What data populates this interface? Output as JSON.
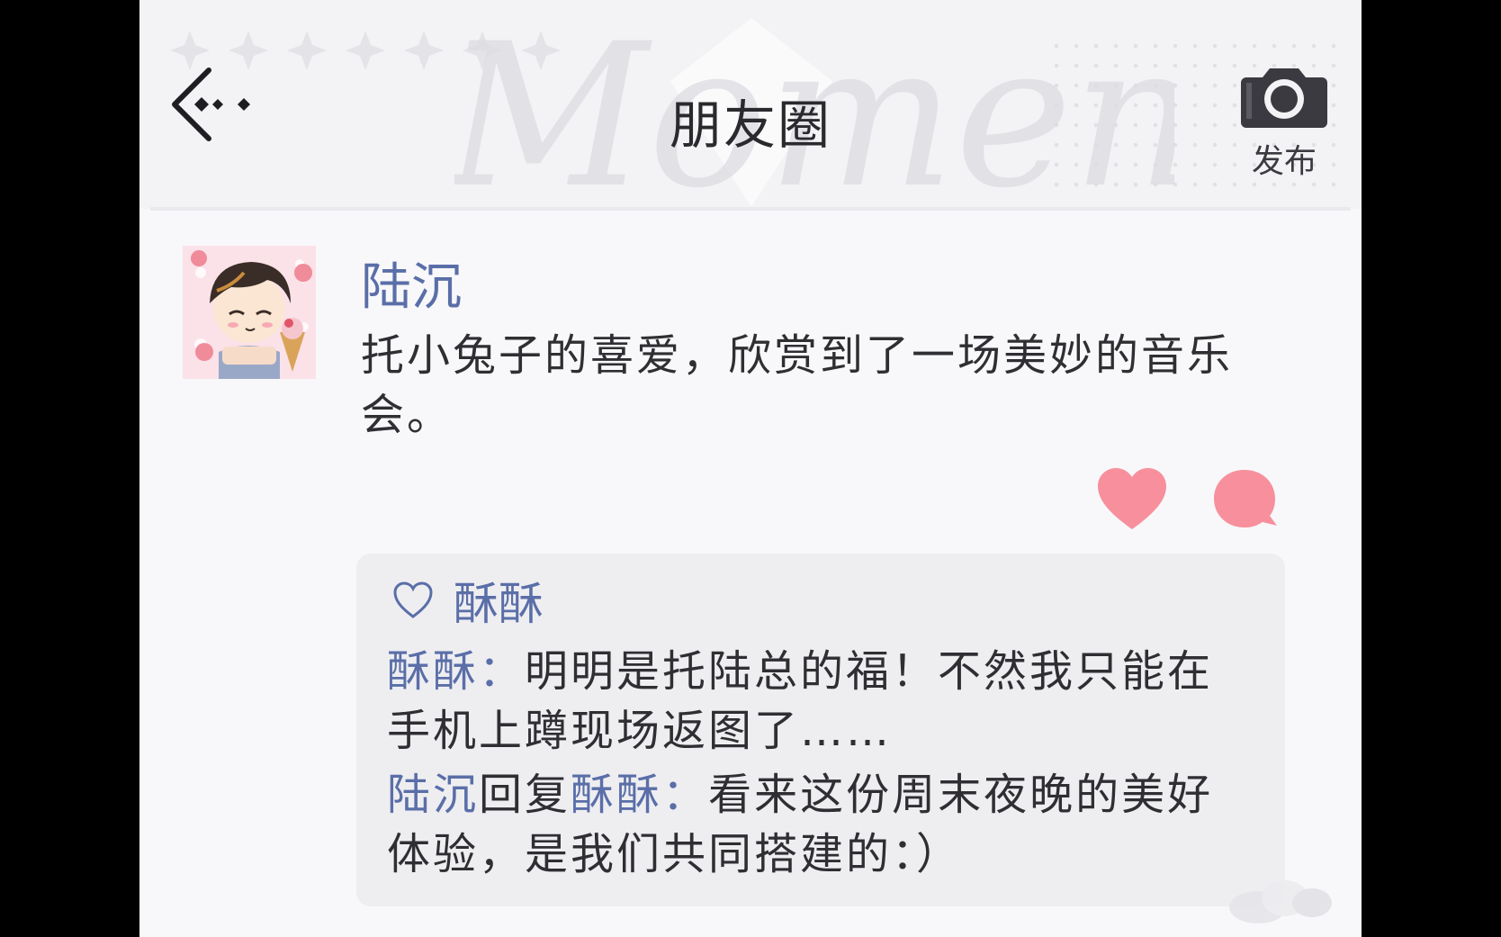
{
  "header": {
    "title": "朋友圈",
    "watermark_text": "Moments",
    "publish_label": "发布"
  },
  "post": {
    "author": "陆沉",
    "text": "托小兔子的喜爱，欣赏到了一场美妙的音乐会。",
    "likes": [
      "酥酥"
    ],
    "comments": [
      {
        "author": "酥酥",
        "reply_to": "",
        "reply_word": "",
        "separator": "：",
        "text": "明明是托陆总的福！不然我只能在手机上蹲现场返图了……"
      },
      {
        "author": "陆沉",
        "reply_word": "回复",
        "reply_to": "酥酥",
        "separator": "：",
        "text": "看来这份周末夜晚的美好体验，是我们共同搭建的：）"
      }
    ]
  },
  "colors": {
    "accent_name": "#5a6ea8",
    "heart_pink": "#f7909c",
    "background": "#f8f8fa"
  },
  "icons": {
    "back": "back-arrow-icon",
    "camera": "camera-icon",
    "like": "heart-icon",
    "comment": "comment-bubble-icon",
    "likes_list": "outline-heart-icon"
  }
}
